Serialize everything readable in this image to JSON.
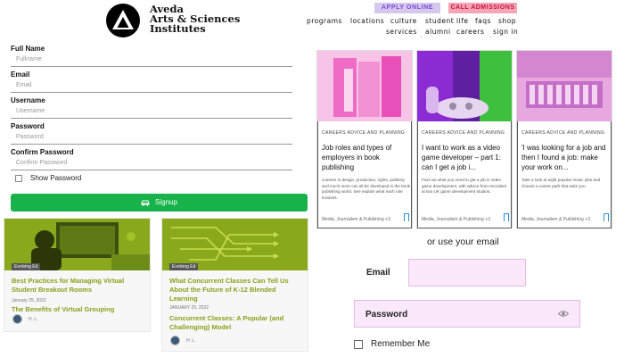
{
  "header": {
    "logo_lines": [
      "Aveda",
      "Arts & Sciences",
      "Institutes"
    ],
    "apply_label": "APPLY ONLINE",
    "call_label": "CALL ADMISSIONS",
    "nav_top": [
      "programs",
      "locations",
      "culture",
      "student life",
      "faqs",
      "shop"
    ],
    "nav_bottom": [
      "services",
      "alumni",
      "careers",
      "sign in"
    ]
  },
  "signup": {
    "full_name_label": "Full Name",
    "full_name_placeholder": "Fullname",
    "email_label": "Email",
    "email_placeholder": "Email",
    "username_label": "Username",
    "username_placeholder": "Username",
    "password_label": "Password",
    "password_placeholder": "Password",
    "confirm_label": "Confirm Password",
    "confirm_placeholder": "Confirm Password",
    "show_password_label": "Show Password",
    "signup_label": "Signup"
  },
  "blog": [
    {
      "tag": "Evolving Ed",
      "title": "Best Practices for Managing Virtual Student Breakout Rooms",
      "date": "January 25, 2022",
      "subtitle": "The Benefits of Virtual Grouping",
      "author": "H. L."
    },
    {
      "tag": "Evolving Ed",
      "title": "What Concurrent Classes Can Tell Us About the Future of K-12 Blended Learning",
      "date": "JANUARY 25, 2022",
      "subtitle": "Concurrent Classes: A Popular (and Challenging) Model",
      "author": "H. L."
    }
  ],
  "careers": [
    {
      "category": "CAREERS ADVICE AND PLANNING",
      "title": "Job roles and types of employers in book publishing",
      "desc": "Careers in design, production, rights, publicity and much more can all be developed in the book publishing world. See explain what each role involves.",
      "footer": "Media, Journalism & Publishing +3"
    },
    {
      "category": "CAREERS ADVICE AND PLANNING",
      "title": "I want to work as a video game developer – part 1: can I get a job i...",
      "desc": "Find out what you need to get a job in video game development, with advice from recruiters at two UK game development studios.",
      "footer": "Media, Journalism & Publishing +3"
    },
    {
      "category": "CAREERS ADVICE AND PLANNING",
      "title": "'I was looking for a job and then I found a job: make your work on...",
      "desc": "Take a look at eight popular music jobs and choose a career path that suits you.",
      "footer": "Media, Journalism & Publishing +3"
    }
  ],
  "login": {
    "or_use": "or use your email",
    "email_label": "Email",
    "password_label": "Password",
    "remember_label": "Remember Me"
  },
  "colors": {
    "signup_green": "#17b24a",
    "blog_title_olive": "#8a9e1a",
    "input_pink": "#fbe9fb",
    "apply_purple": "#d6c7ee",
    "call_pink": "#f4a6b7"
  }
}
